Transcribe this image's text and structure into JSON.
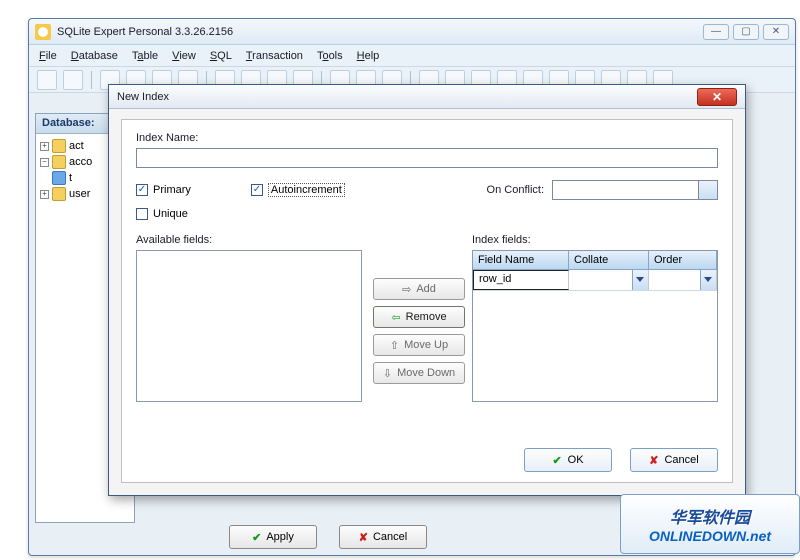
{
  "main_window": {
    "title": "SQLite Expert Personal 3.3.26.2156",
    "db_panel_header": "Database:"
  },
  "menubar": {
    "items": [
      "File",
      "Database",
      "Table",
      "View",
      "SQL",
      "Transaction",
      "Tools",
      "Help"
    ]
  },
  "tree": {
    "items": [
      {
        "label": "act"
      },
      {
        "label": "acco"
      },
      {
        "label": "t"
      },
      {
        "label": "user"
      }
    ]
  },
  "main_buttons": {
    "apply": "Apply",
    "cancel": "Cancel"
  },
  "dialog": {
    "title": "New Index",
    "index_name_label": "Index Name:",
    "index_name_value": "",
    "primary_label": "Primary",
    "primary_checked": true,
    "autoincrement_label": "Autoincrement",
    "autoincrement_checked": true,
    "unique_label": "Unique",
    "unique_checked": false,
    "on_conflict_label": "On Conflict:",
    "on_conflict_value": "",
    "available_label": "Available fields:",
    "index_fields_label": "Index fields:",
    "buttons": {
      "add": "Add",
      "remove": "Remove",
      "move_up": "Move Up",
      "move_down": "Move Down",
      "ok": "OK",
      "cancel": "Cancel"
    },
    "index_grid": {
      "headers": {
        "field_name": "Field Name",
        "collate": "Collate",
        "order": "Order"
      },
      "rows": [
        {
          "field_name": "row_id",
          "collate": "",
          "order": ""
        }
      ]
    }
  },
  "watermark": {
    "line1": "华军软件园",
    "line2": "ONLINEDOWN.net"
  }
}
